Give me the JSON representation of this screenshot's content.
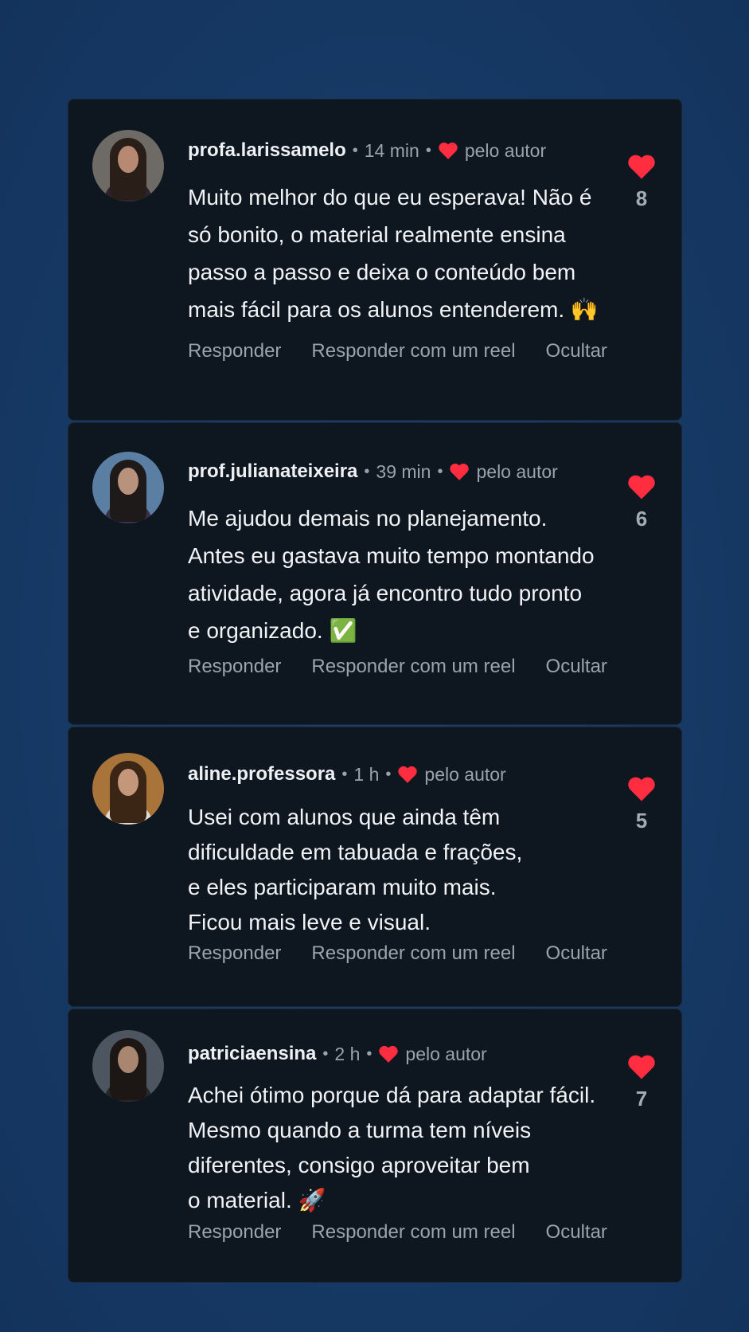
{
  "comments": [
    {
      "username": "profa.larissamelo",
      "time": "14 min",
      "author_liked_label": "pelo autor",
      "text": "Muito melhor do que eu esperava! Não é\nsó bonito, o material realmente ensina\npasso a passo e deixa o conteúdo bem\nmais fácil para os alunos entenderem. 🙌",
      "likes": "8",
      "actions": {
        "reply": "Responder",
        "reply_reel": "Responder com um reel",
        "hide": "Ocultar"
      }
    },
    {
      "username": "prof.julianateixeira",
      "time": "39 min",
      "author_liked_label": "pelo autor",
      "text": "Me ajudou demais no planejamento.\nAntes eu gastava muito tempo montando\natividade, agora já encontro tudo pronto\ne organizado. ✅",
      "likes": "6",
      "actions": {
        "reply": "Responder",
        "reply_reel": "Responder com um reel",
        "hide": "Ocultar"
      }
    },
    {
      "username": "aline.professora",
      "time": "1 h",
      "author_liked_label": "pelo autor",
      "text": "Usei com alunos que ainda têm\ndificuldade em tabuada e frações,\ne eles participaram muito mais.\nFicou mais leve e visual.",
      "likes": "5",
      "actions": {
        "reply": "Responder",
        "reply_reel": "Responder com um reel",
        "hide": "Ocultar"
      }
    },
    {
      "username": "patriciaensina",
      "time": "2 h",
      "author_liked_label": "pelo autor",
      "text": "Achei ótimo porque dá para adaptar fácil.\nMesmo quando a turma tem níveis\ndiferentes, consigo aproveitar bem\no material. 🚀",
      "likes": "7",
      "actions": {
        "reply": "Responder",
        "reply_reel": "Responder com um reel",
        "hide": "Ocultar"
      }
    }
  ],
  "colors": {
    "background": "#173a68",
    "card": "#0e1620",
    "heart": "#ff2d3f",
    "muted_text": "#9aa3ad"
  },
  "avatar_backgrounds": [
    "#6e6a66",
    "#5b7fa3",
    "#a8743a",
    "#4c5560"
  ]
}
